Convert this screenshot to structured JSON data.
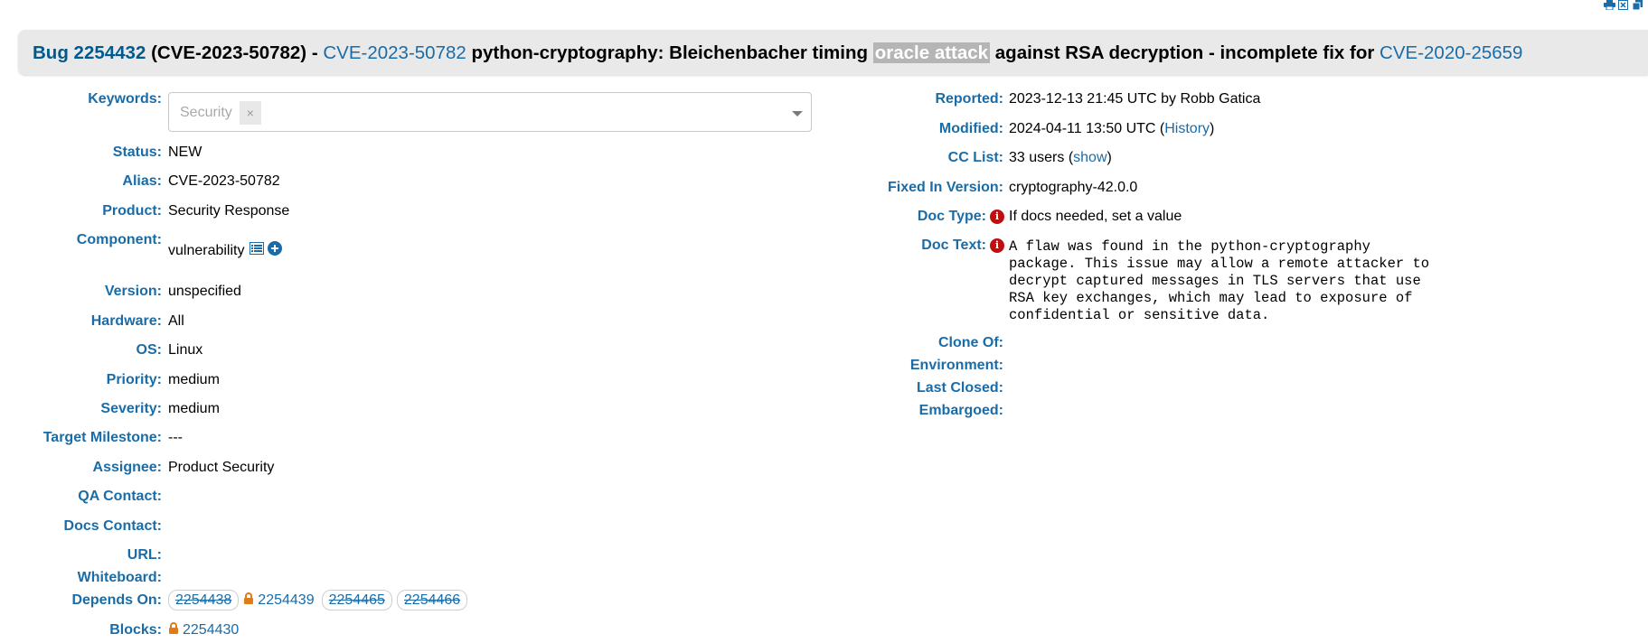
{
  "colors": {
    "link": "#1a6ca8",
    "title_bg": "#e9e9e9",
    "info_red": "#c20d0d",
    "lock_orange": "#e07a1a"
  },
  "toolbar_icons": [
    "print-icon",
    "excel-icon",
    "copy-icon"
  ],
  "title": {
    "bug_link": "Bug 2254432",
    "alias_part": "(CVE-2023-50782) -",
    "cve_link": "CVE-2023-50782",
    "summary_before": "python-cryptography: Bleichenbacher timing",
    "summary_highlight": "oracle attack",
    "summary_after": "against RSA decryption - incomplete fix for",
    "ref_cve_link": "CVE-2020-25659"
  },
  "left": {
    "keywords": {
      "label": "Keywords:",
      "chip": "Security",
      "chip_remove": "×"
    },
    "status": {
      "label": "Status:",
      "value": "NEW"
    },
    "alias": {
      "label": "Alias:",
      "value": "CVE-2023-50782"
    },
    "product": {
      "label": "Product:",
      "value": "Security Response"
    },
    "component": {
      "label": "Component:",
      "value": "vulnerability"
    },
    "version": {
      "label": "Version:",
      "value": "unspecified"
    },
    "hardware": {
      "label": "Hardware:",
      "value": "All"
    },
    "os": {
      "label": "OS:",
      "value": "Linux"
    },
    "priority": {
      "label": "Priority:",
      "value": "medium"
    },
    "severity": {
      "label": "Severity:",
      "value": "medium"
    },
    "target_milestone": {
      "label": "Target Milestone:",
      "value": "---"
    },
    "assignee": {
      "label": "Assignee:",
      "value": "Product Security"
    },
    "qa_contact": {
      "label": "QA Contact:",
      "value": ""
    },
    "docs_contact": {
      "label": "Docs Contact:",
      "value": ""
    },
    "url": {
      "label": "URL:",
      "value": ""
    },
    "whiteboard": {
      "label": "Whiteboard:",
      "value": ""
    },
    "depends_on": {
      "label": "Depends On:",
      "bugs": [
        "2254438",
        "2254439",
        "2254465",
        "2254466"
      ]
    },
    "blocks": {
      "label": "Blocks:",
      "bug": "2254430"
    }
  },
  "right": {
    "reported": {
      "label": "Reported:",
      "value": "2023-12-13 21:45 UTC by Robb Gatica"
    },
    "modified": {
      "label": "Modified:",
      "value_before": "2024-04-11 13:50 UTC (",
      "link": "History",
      "value_after": ")"
    },
    "cc_list": {
      "label": "CC List:",
      "value_before": "33 users (",
      "link": "show",
      "value_after": ")"
    },
    "fixed_in": {
      "label": "Fixed In Version:",
      "value": "cryptography-42.0.0"
    },
    "doc_type": {
      "label": "Doc Type:",
      "value": "If docs needed, set a value",
      "icon": "i"
    },
    "doc_text": {
      "label": "Doc Text:",
      "icon": "i",
      "value": "A flaw was found in the python-cryptography\npackage. This issue may allow a remote attacker to\ndecrypt captured messages in TLS servers that use\nRSA key exchanges, which may lead to exposure of\nconfidential or sensitive data."
    },
    "clone_of": {
      "label": "Clone Of:",
      "value": ""
    },
    "environment": {
      "label": "Environment:",
      "value": ""
    },
    "last_closed": {
      "label": "Last Closed:",
      "value": ""
    },
    "embargoed": {
      "label": "Embargoed:",
      "value": ""
    }
  }
}
